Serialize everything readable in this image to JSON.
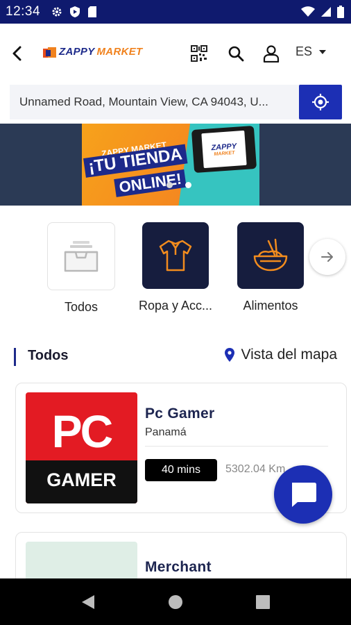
{
  "status_bar": {
    "time": "12:34",
    "left_icons": [
      "gear-icon",
      "shield-icon",
      "sd-card-icon"
    ],
    "right_icons": [
      "wifi-icon",
      "signal-icon",
      "battery-icon"
    ]
  },
  "header": {
    "logo": {
      "part1": "ZAPPY",
      "part2": "MARKET"
    },
    "language": "ES"
  },
  "address": {
    "value": "Unnamed Road, Mountain View, CA 94043, U..."
  },
  "banner": {
    "subtitle": "ZAPPY MARKET",
    "title_line1": "¡TU TIENDA",
    "title_line2": "ONLINE!",
    "tablet_brand1": "ZAPPY",
    "tablet_brand2": "MARKET",
    "active_slide": 1,
    "slide_count": 2
  },
  "categories": [
    {
      "label": "Todos",
      "icon": "inbox-tray-icon",
      "style": "light"
    },
    {
      "label": "Ropa y Acc...",
      "icon": "polo-shirt-icon",
      "style": "dark"
    },
    {
      "label": "Alimentos",
      "icon": "food-bowl-icon",
      "style": "dark"
    }
  ],
  "section": {
    "title": "Todos",
    "map_link": "Vista del mapa"
  },
  "merchants": [
    {
      "name": "Pc Gamer",
      "location": "Panamá",
      "delivery_time": "40 mins",
      "distance": "5302.04 Km",
      "logo_top": "PC",
      "logo_bottom": "GAMER"
    },
    {
      "name": "Merchant"
    }
  ],
  "colors": {
    "brand_blue": "#1c2fb4",
    "brand_navy": "#1d2a8a",
    "brand_orange": "#f0821e",
    "status_bar": "#0f1a6e",
    "category_dark": "#161d3e",
    "pc_red": "#e31b23"
  }
}
